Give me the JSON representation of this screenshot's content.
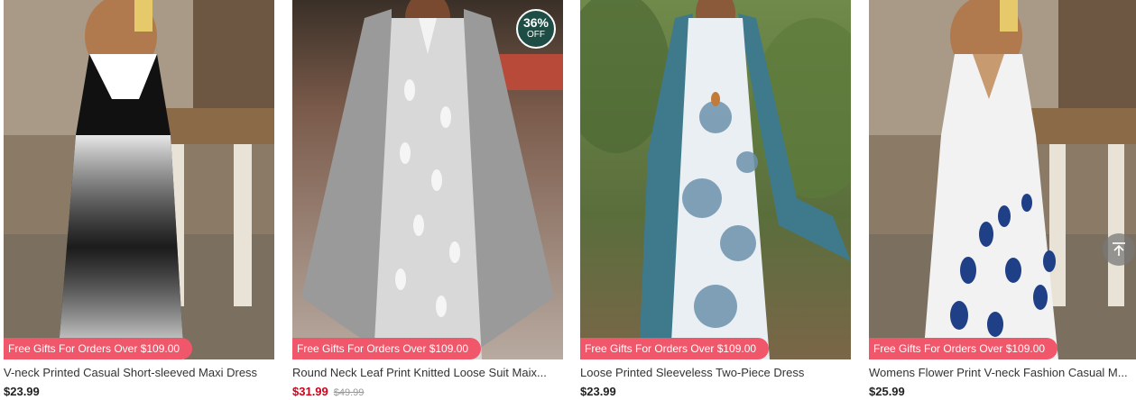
{
  "colors": {
    "promo_bg": "#f0576a",
    "sale_price": "#d0021b",
    "discount_badge": "#1d4d45"
  },
  "products": [
    {
      "title": "V-neck Printed Casual Short-sleeved Maxi Dress",
      "price": "$23.99",
      "promo": "Free Gifts For Orders Over $109.00"
    },
    {
      "title": "Round Neck Leaf Print Knitted Loose Suit Maix...",
      "price": "$31.99",
      "original_price": "$49.99",
      "discount": "36%",
      "discount_suffix": "OFF",
      "promo": "Free Gifts For Orders Over $109.00"
    },
    {
      "title": "Loose Printed Sleeveless Two-Piece Dress",
      "price": "$23.99",
      "promo": "Free Gifts For Orders Over $109.00"
    },
    {
      "title": "Womens Flower Print V-neck Fashion Casual M...",
      "price": "$25.99",
      "promo": "Free Gifts For Orders Over $109.00"
    }
  ],
  "back_to_top_icon": "arrow-up-to-line-icon"
}
